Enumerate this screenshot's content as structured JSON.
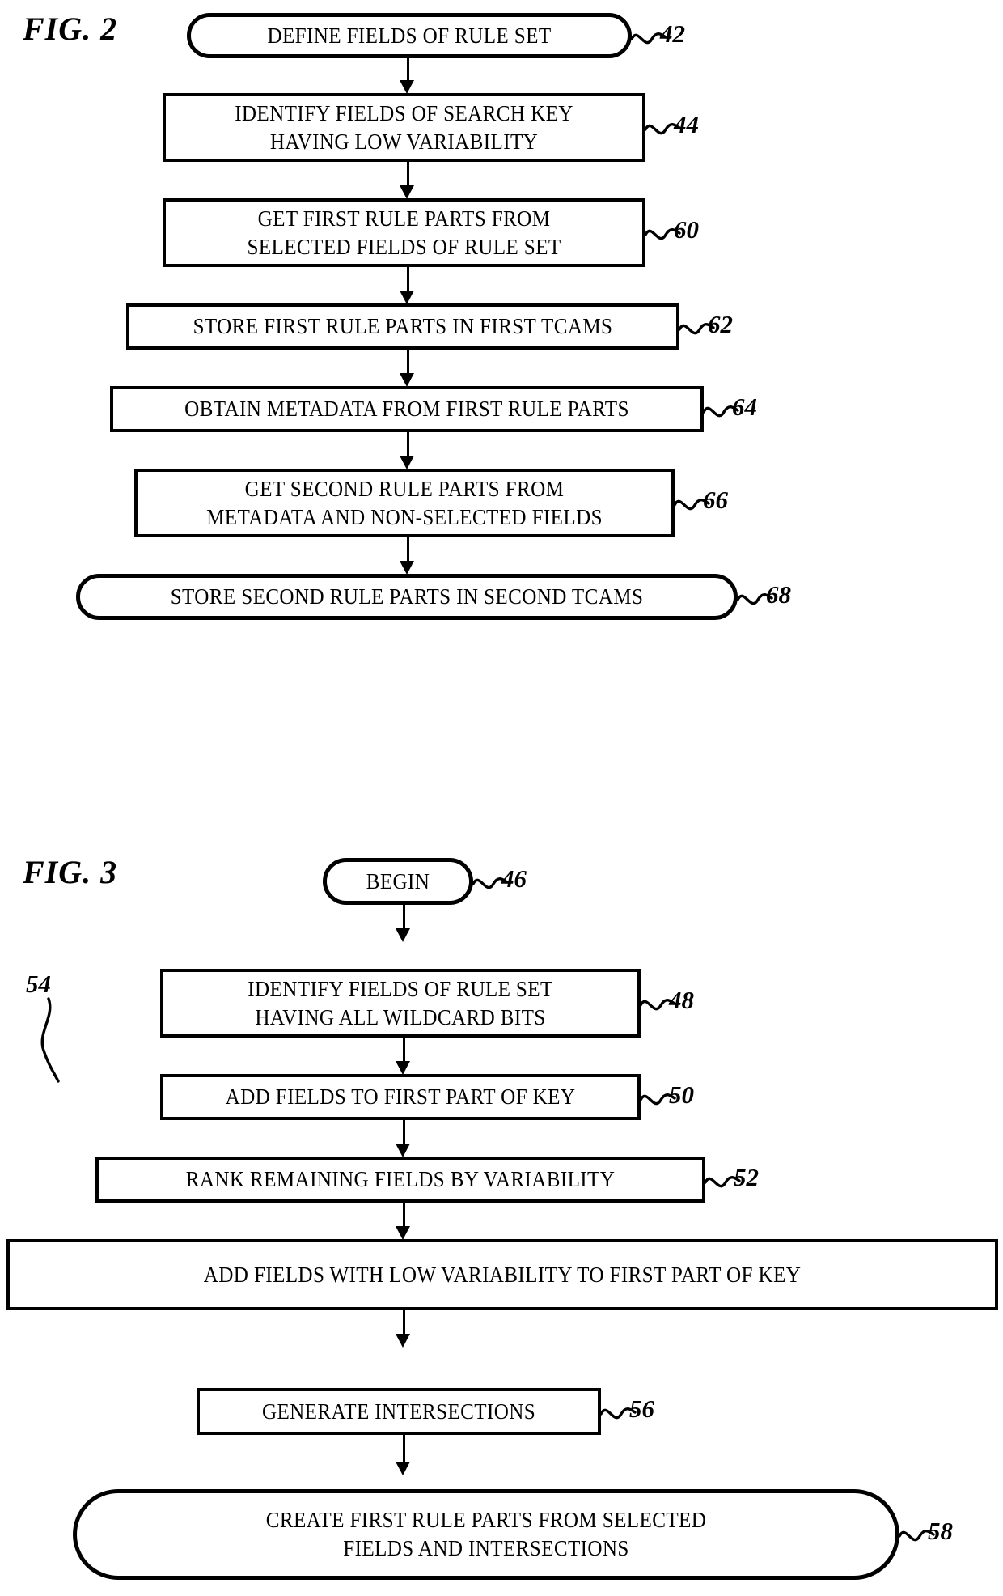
{
  "document": {
    "type": "patent-flowchart-sheet",
    "figures": [
      {
        "caption": "FIG. 2",
        "nodes": [
          {
            "ref": "42",
            "shape": "terminator",
            "lines": [
              "DEFINE FIELDS OF RULE SET"
            ]
          },
          {
            "ref": "44",
            "shape": "process",
            "lines": [
              "IDENTIFY FIELDS OF SEARCH KEY",
              "HAVING LOW VARIABILITY"
            ]
          },
          {
            "ref": "60",
            "shape": "process",
            "lines": [
              "GET FIRST RULE PARTS FROM",
              "SELECTED FIELDS OF RULE SET"
            ]
          },
          {
            "ref": "62",
            "shape": "process",
            "lines": [
              "STORE FIRST RULE PARTS IN FIRST TCAMS"
            ]
          },
          {
            "ref": "64",
            "shape": "process",
            "lines": [
              "OBTAIN METADATA FROM FIRST RULE PARTS"
            ]
          },
          {
            "ref": "66",
            "shape": "process",
            "lines": [
              "GET SECOND RULE PARTS FROM",
              "METADATA AND NON-SELECTED FIELDS"
            ]
          },
          {
            "ref": "68",
            "shape": "terminator",
            "lines": [
              "STORE SECOND RULE PARTS IN SECOND TCAMS"
            ]
          }
        ]
      },
      {
        "caption": "FIG. 3",
        "nodes": [
          {
            "ref": "46",
            "shape": "terminator",
            "lines": [
              "BEGIN"
            ]
          },
          {
            "ref": "48",
            "shape": "process",
            "lines": [
              "IDENTIFY FIELDS OF RULE SET",
              "HAVING ALL WILDCARD BITS"
            ]
          },
          {
            "ref": "50",
            "shape": "process",
            "lines": [
              "ADD FIELDS TO FIRST PART OF KEY"
            ]
          },
          {
            "ref": "52",
            "shape": "process",
            "lines": [
              "RANK REMAINING FIELDS BY VARIABILITY"
            ]
          },
          {
            "ref": "54",
            "shape": "process",
            "lines": [
              "ADD FIELDS WITH LOW VARIABILITY TO FIRST PART OF KEY"
            ]
          },
          {
            "ref": "56",
            "shape": "process",
            "lines": [
              "GENERATE INTERSECTIONS"
            ]
          },
          {
            "ref": "58",
            "shape": "terminator",
            "lines": [
              "CREATE FIRST RULE PARTS FROM SELECTED",
              "FIELDS AND INTERSECTIONS"
            ]
          }
        ]
      }
    ]
  },
  "colors": {
    "ink": "#000000",
    "paper": "#ffffff"
  }
}
